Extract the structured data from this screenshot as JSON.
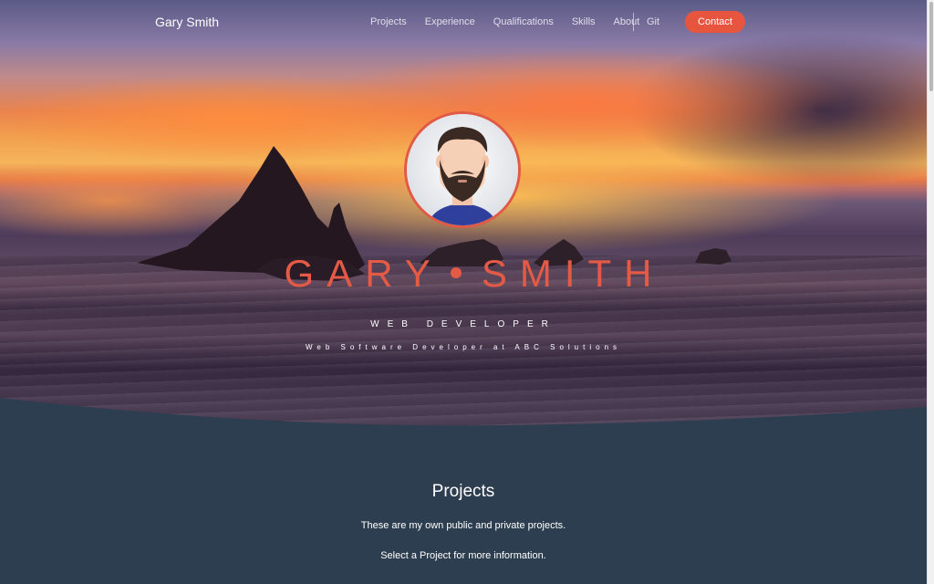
{
  "nav": {
    "brand": "Gary Smith",
    "links": [
      "Projects",
      "Experience",
      "Qualifications",
      "Skills",
      "About"
    ],
    "git": "Git",
    "contact": "Contact"
  },
  "hero": {
    "first_name": "GARY",
    "last_name": "SMITH",
    "role": "WEB DEVELOPER",
    "subtitle": "Web Software Developer at ABC Solutions",
    "avatar_icon": "bearded-man-avatar-icon"
  },
  "projects": {
    "title": "Projects",
    "description": "These are my own public and private projects.",
    "hint": "Select a Project for more information."
  },
  "colors": {
    "accent": "#e8553f",
    "section_bg": "#2d3e50",
    "nav_text": "#ffffff"
  }
}
